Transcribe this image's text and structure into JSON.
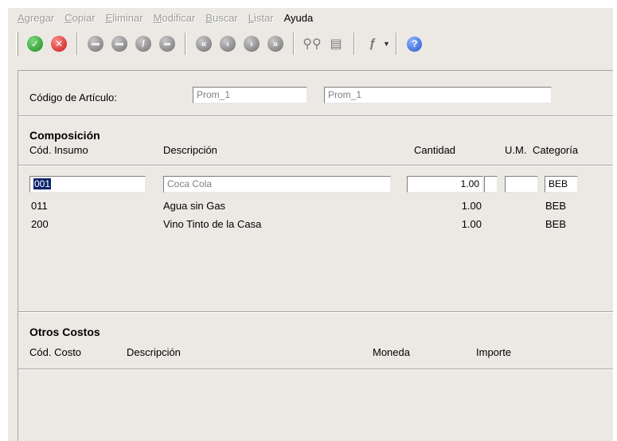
{
  "menu": {
    "items": [
      {
        "label": "Agregar",
        "first": "A",
        "rest": "gregar",
        "enabled": false
      },
      {
        "label": "Copiar",
        "first": "C",
        "rest": "opiar",
        "enabled": false
      },
      {
        "label": "Eliminar",
        "first": "E",
        "rest": "liminar",
        "enabled": false
      },
      {
        "label": "Modificar",
        "first": "M",
        "rest": "odificar",
        "enabled": false
      },
      {
        "label": "Buscar",
        "first": "B",
        "rest": "uscar",
        "enabled": false
      },
      {
        "label": "Listar",
        "first": "L",
        "rest": "istar",
        "enabled": false
      },
      {
        "label": "Ayuda",
        "first": "Ay",
        "rest": "uda",
        "enabled": true
      }
    ]
  },
  "toolbar": {
    "icons": [
      "check-icon",
      "cancel-icon",
      "first-icon",
      "previous-icon",
      "next-icon",
      "last-icon",
      "record-first-icon",
      "record-previous-icon",
      "record-next-icon",
      "record-last-icon",
      "binoculars-icon",
      "print-preview-icon",
      "tools-icon",
      "help-icon"
    ],
    "colors": {
      "accept": "#1e8f1e",
      "cancel": "#c81818",
      "help": "#2553c9"
    }
  },
  "header": {
    "codigo_label": "Código de Artículo:",
    "codigo_value": "Prom_1",
    "descripcion_value": "Prom_1"
  },
  "composicion": {
    "title": "Composición",
    "col_insumo": "Cód. Insumo",
    "col_descripcion": "Descripción",
    "col_cantidad": "Cantidad",
    "col_um": "U.M.",
    "col_categoria": "Categoría",
    "edit_row": {
      "codigo": "001",
      "descripcion": "Coca Cola",
      "cantidad": "1.00",
      "um": "",
      "categoria": "BEB"
    },
    "rows": [
      {
        "codigo": "011",
        "descripcion": "Agua sin Gas",
        "cantidad": "1.00",
        "categoria": "BEB"
      },
      {
        "codigo": "200",
        "descripcion": "Vino Tinto de la Casa",
        "cantidad": "1.00",
        "categoria": "BEB"
      }
    ]
  },
  "otros_costos": {
    "title": "Otros Costos",
    "col_codigo": "Cód. Costo",
    "col_descripcion": "Descripción",
    "col_moneda": "Moneda",
    "col_importe": "Importe"
  }
}
